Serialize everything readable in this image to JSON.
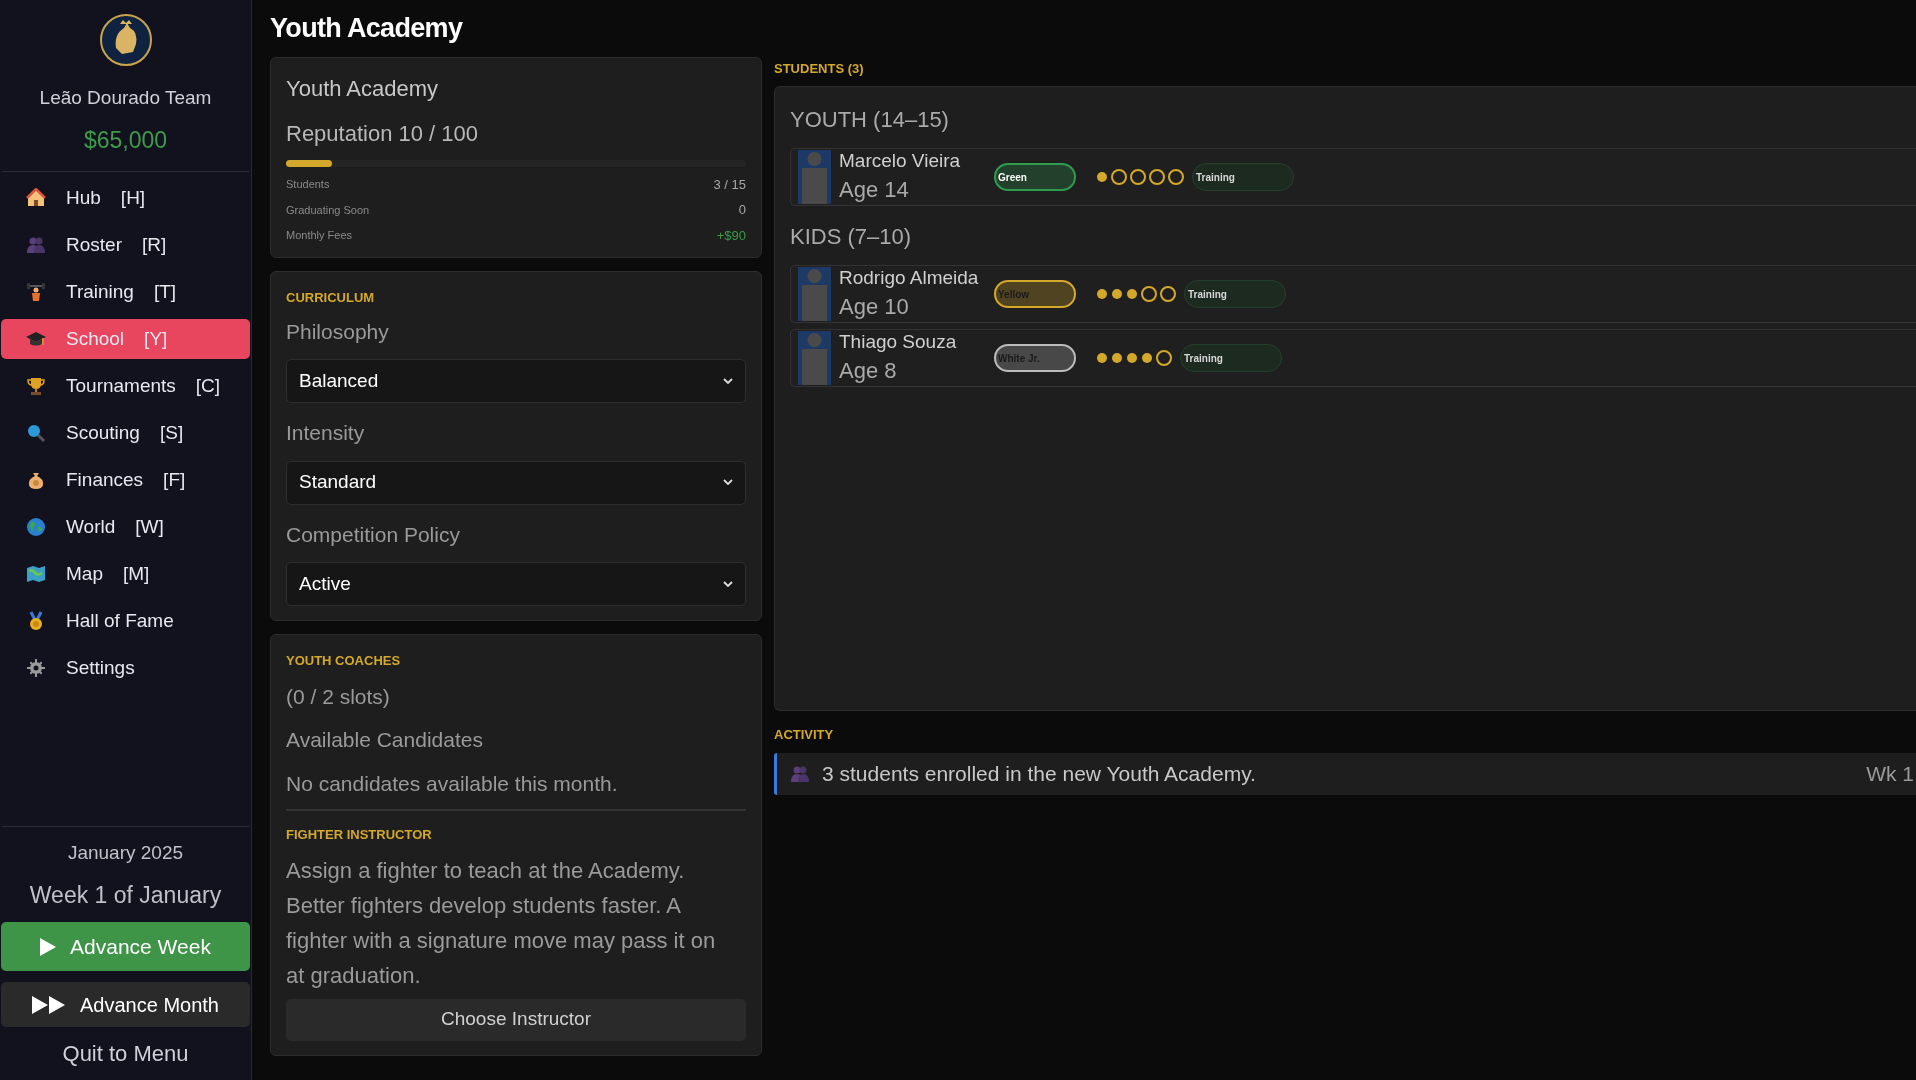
{
  "header": {
    "title": "Youth Academy"
  },
  "sidebar": {
    "team": "Leão Dourado Team",
    "money": "$65,000",
    "nav": [
      {
        "label": "Hub",
        "shortcut": "[H]",
        "selected": false
      },
      {
        "label": "Roster",
        "shortcut": "[R]",
        "selected": false
      },
      {
        "label": "Training",
        "shortcut": "[T]",
        "selected": false
      },
      {
        "label": "School",
        "shortcut": "[Y]",
        "selected": true
      },
      {
        "label": "Tournaments",
        "shortcut": "[C]",
        "selected": false
      },
      {
        "label": "Scouting",
        "shortcut": "[S]",
        "selected": false
      },
      {
        "label": "Finances",
        "shortcut": "[F]",
        "selected": false
      },
      {
        "label": "World",
        "shortcut": "[W]",
        "selected": false
      },
      {
        "label": "Map",
        "shortcut": "[M]",
        "selected": false
      },
      {
        "label": "Hall of Fame",
        "selected": false
      },
      {
        "label": "Settings",
        "selected": false
      }
    ],
    "month": "January 2025",
    "week": "Week 1 of January",
    "advance_week": "Advance Week",
    "advance_month": "Advance Month",
    "quit": "Quit to Menu"
  },
  "academy": {
    "title": "Youth Academy",
    "reputation": "Reputation 10 / 100",
    "level": 0.1,
    "stats": [
      {
        "label": "Students",
        "value": "3 / 15",
        "kind": "plain"
      },
      {
        "label": "Graduating Soon",
        "value": "0",
        "kind": "plain"
      },
      {
        "label": "Monthly Fees",
        "value": "+$90",
        "kind": "positive"
      }
    ]
  },
  "curriculum": {
    "title": "CURRICULUM",
    "fields": [
      {
        "label": "Philosophy",
        "value": "Balanced"
      },
      {
        "label": "Intensity",
        "value": "Standard"
      },
      {
        "label": "Competition Policy",
        "value": "Active"
      }
    ]
  },
  "coaches": {
    "title": "YOUTH COACHES",
    "slots": "(0 / 2 slots)",
    "subtitle": "Available Candidates",
    "empty": "No candidates available this month.",
    "instructor_title": "FIGHTER INSTRUCTOR",
    "instructor_text": "Assign a fighter to teach at the Academy. Better fighters develop students faster. A fighter with a signature move may pass it on at graduation.",
    "button": "Choose Instructor"
  },
  "students": {
    "title": "STUDENTS (3)",
    "groups": [
      {
        "title": "YOUTH (14–15)",
        "students": [
          {
            "name": "Marcelo Vieira",
            "age": "Age 14",
            "belt": "Green",
            "color": "#2e9e4e",
            "stars": 1,
            "status": "Training"
          }
        ]
      },
      {
        "title": "KIDS (7–10)",
        "students": [
          {
            "name": "Rodrigo Almeida",
            "age": "Age 10",
            "belt": "Yellow",
            "color": "#d4a82a",
            "stars": 3,
            "status": "Training"
          },
          {
            "name": "Thiago Souza",
            "age": "Age 8",
            "belt": "White Jr.",
            "color": "#bbbbbb",
            "stars": 4,
            "status": "Training"
          }
        ]
      }
    ]
  },
  "activity": {
    "title": "ACTIVITY",
    "entries": [
      {
        "text": "3 students enrolled in the new Youth Academy.",
        "week": "Wk 1"
      }
    ]
  }
}
